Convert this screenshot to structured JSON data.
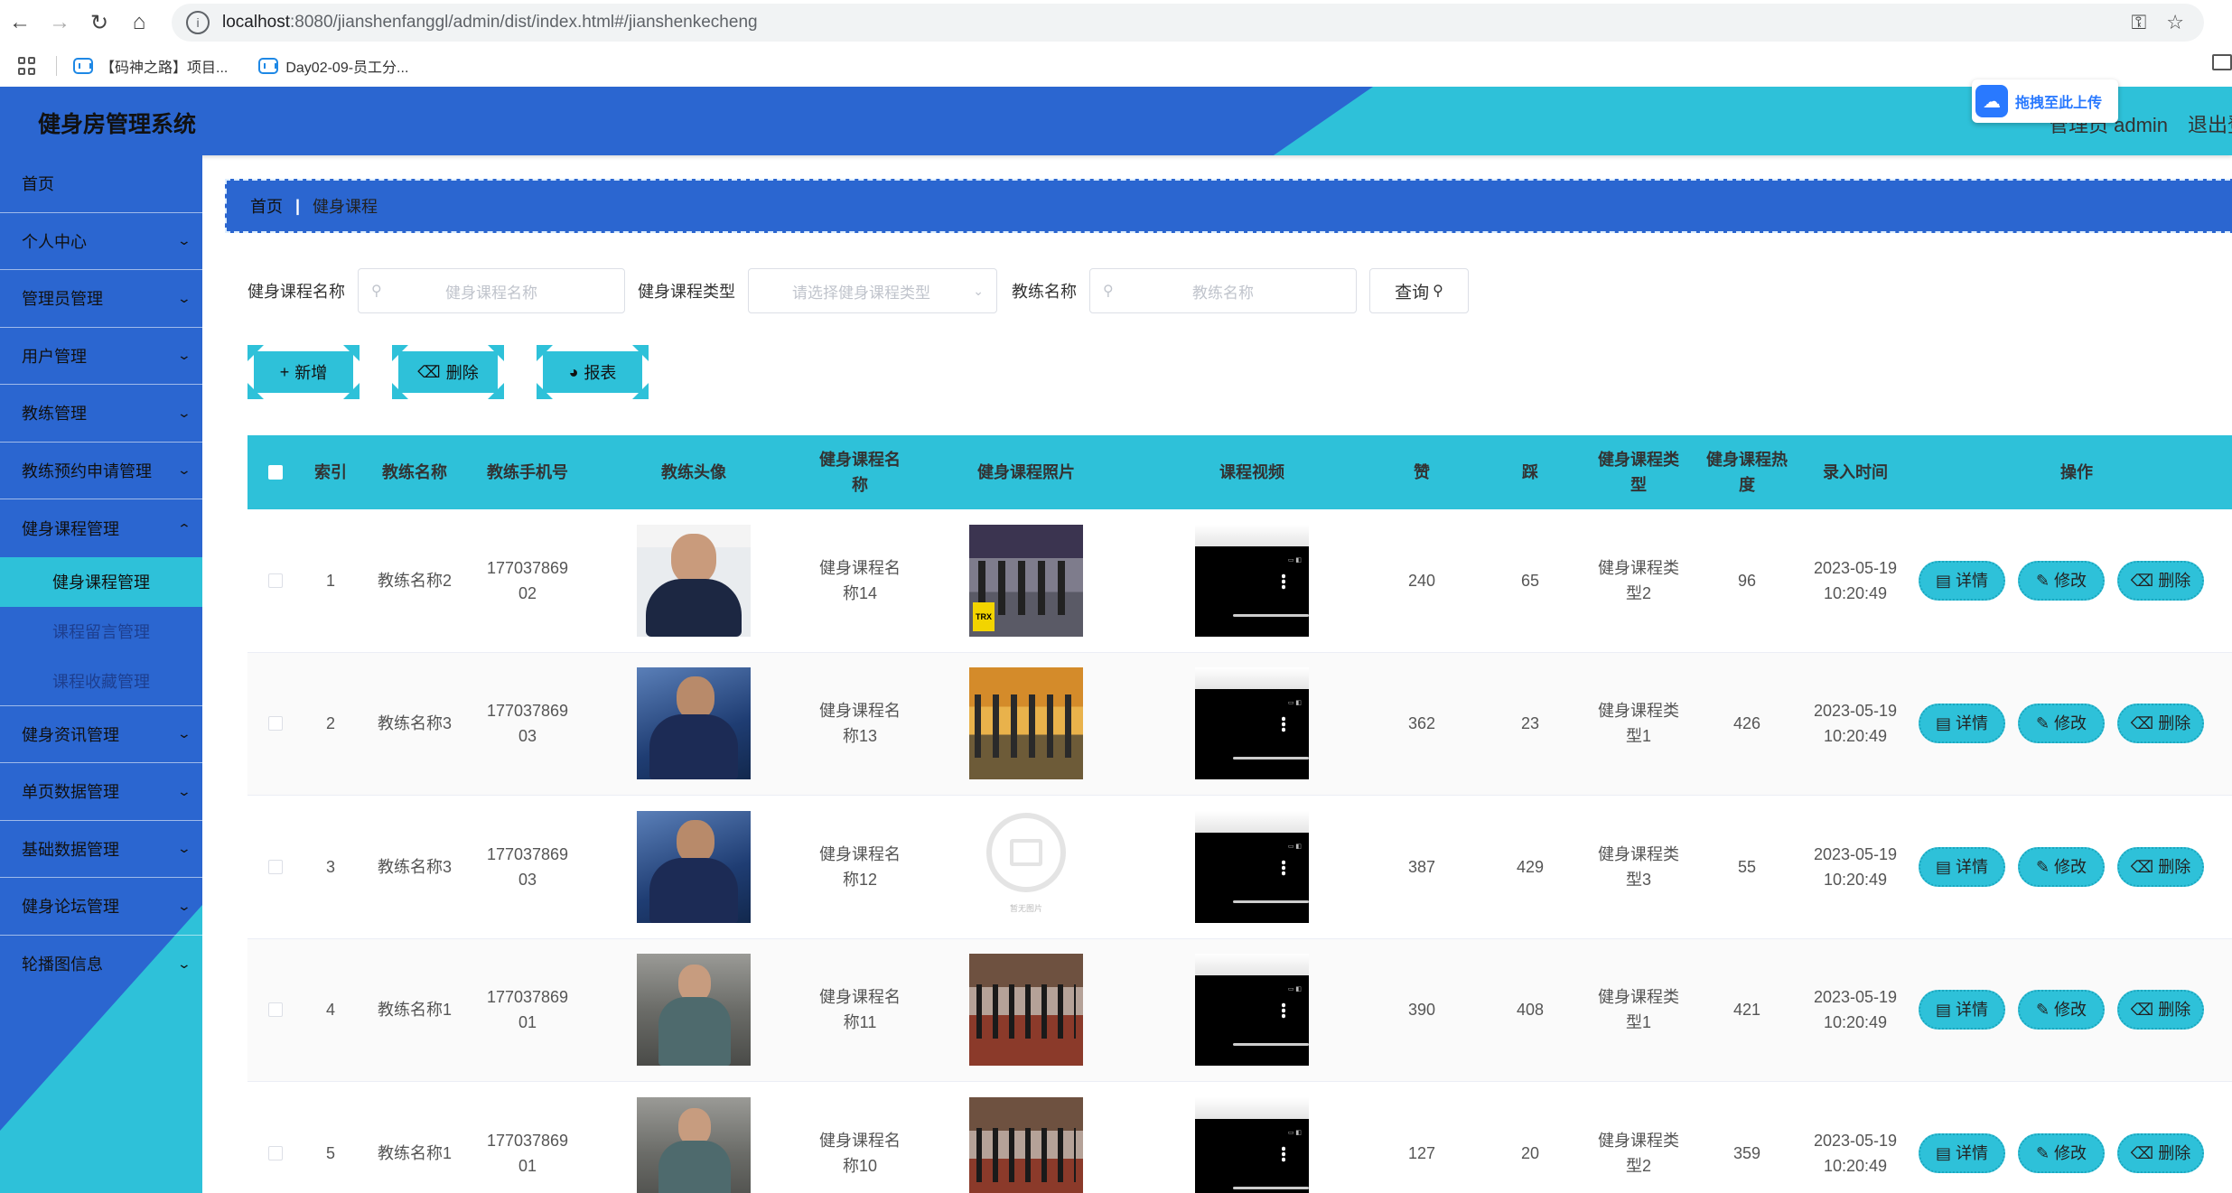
{
  "browser": {
    "url_host": "localhost",
    "url_path": ":8080/jianshenfanggl/admin/dist/index.html#/jianshenkecheng",
    "bookmarks": [
      "【码神之路】项目...",
      "Day02-09-员工分..."
    ]
  },
  "header": {
    "title": "健身房管理系统",
    "user": "管理员 admin",
    "logout": "退出登",
    "upload_label": "拖拽至此上传"
  },
  "sidebar": {
    "items": [
      {
        "label": "首页"
      },
      {
        "label": "个人中心"
      },
      {
        "label": "管理员管理"
      },
      {
        "label": "用户管理"
      },
      {
        "label": "教练管理"
      },
      {
        "label": "教练预约申请管理"
      },
      {
        "label": "健身课程管理"
      }
    ],
    "sub_items": [
      {
        "label": "健身课程管理"
      },
      {
        "label": "课程留言管理"
      },
      {
        "label": "课程收藏管理"
      }
    ],
    "items_after": [
      {
        "label": "健身资讯管理"
      },
      {
        "label": "单页数据管理"
      },
      {
        "label": "基础数据管理"
      },
      {
        "label": "健身论坛管理"
      },
      {
        "label": "轮播图信息"
      }
    ]
  },
  "breadcrumb": {
    "home": "首页",
    "current": "健身课程"
  },
  "search": {
    "name_label": "健身课程名称",
    "name_placeholder": "健身课程名称",
    "type_label": "健身课程类型",
    "type_placeholder": "请选择健身课程类型",
    "coach_label": "教练名称",
    "coach_placeholder": "教练名称",
    "query_label": "查询"
  },
  "actions": {
    "add": "新增",
    "delete": "删除",
    "report": "报表"
  },
  "table": {
    "headers": {
      "index": "索引",
      "coach_name": "教练名称",
      "coach_phone": "教练手机号",
      "coach_avatar": "教练头像",
      "course_name": "健身课程名称",
      "course_photo": "健身课程照片",
      "course_video": "课程视频",
      "likes": "赞",
      "dislikes": "踩",
      "course_type": "健身课程类型",
      "heat": "健身课程热度",
      "created": "录入时间",
      "ops": "操作"
    },
    "rows": [
      {
        "index": "1",
        "coach": "教练名称2",
        "phone": "17703786902",
        "course": "健身课程名称14",
        "likes": "240",
        "dislikes": "65",
        "type": "健身课程类型2",
        "heat": "96",
        "time": "2023-05-19 10:20:49"
      },
      {
        "index": "2",
        "coach": "教练名称3",
        "phone": "17703786903",
        "course": "健身课程名称13",
        "likes": "362",
        "dislikes": "23",
        "type": "健身课程类型1",
        "heat": "426",
        "time": "2023-05-19 10:20:49"
      },
      {
        "index": "3",
        "coach": "教练名称3",
        "phone": "17703786903",
        "course": "健身课程名称12",
        "likes": "387",
        "dislikes": "429",
        "type": "健身课程类型3",
        "heat": "55",
        "time": "2023-05-19 10:20:49"
      },
      {
        "index": "4",
        "coach": "教练名称1",
        "phone": "17703786901",
        "course": "健身课程名称11",
        "likes": "390",
        "dislikes": "408",
        "type": "健身课程类型1",
        "heat": "421",
        "time": "2023-05-19 10:20:49"
      },
      {
        "index": "5",
        "coach": "教练名称1",
        "phone": "17703786901",
        "course": "健身课程名称10",
        "likes": "127",
        "dislikes": "20",
        "type": "健身课程类型2",
        "heat": "359",
        "time": "2023-05-19 10:20:49"
      }
    ],
    "op_labels": {
      "detail": "详情",
      "edit": "修改",
      "delete": "删除"
    },
    "photo_placeholder_caption": "暂无图片"
  }
}
